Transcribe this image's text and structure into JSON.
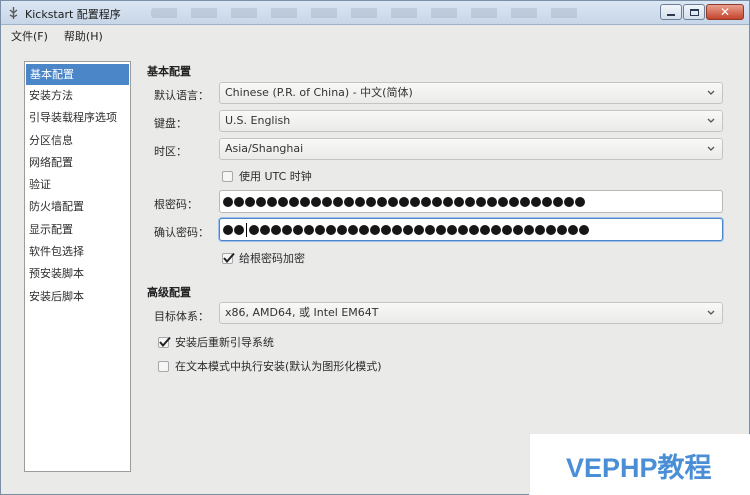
{
  "window": {
    "title": "Kickstart 配置程序",
    "controls": {
      "minimize_icon": "minimize-icon",
      "maximize_icon": "maximize-icon",
      "close_icon": "close-icon"
    }
  },
  "menubar": {
    "items": [
      {
        "label": "文件(F)"
      },
      {
        "label": "帮助(H)"
      }
    ]
  },
  "sidebar": {
    "items": [
      {
        "label": "基本配置",
        "selected": true
      },
      {
        "label": "安装方法"
      },
      {
        "label": "引导装载程序选项"
      },
      {
        "label": "分区信息"
      },
      {
        "label": "网络配置"
      },
      {
        "label": "验证"
      },
      {
        "label": "防火墙配置"
      },
      {
        "label": "显示配置"
      },
      {
        "label": "软件包选择"
      },
      {
        "label": "预安装脚本"
      },
      {
        "label": "安装后脚本"
      }
    ]
  },
  "basic": {
    "title": "基本配置",
    "language_label": "默认语言：",
    "language_value": "Chinese (P.R. of China) - 中文(简体)",
    "keyboard_label": "键盘：",
    "keyboard_value": "U.S. English",
    "timezone_label": "时区：",
    "timezone_value": "Asia/Shanghai",
    "utc_label": "使用 UTC 时钟",
    "utc_checked": false,
    "root_password_label": "根密码：",
    "confirm_password_label": "确认密码：",
    "encrypt_label": "给根密码加密",
    "encrypt_checked": true
  },
  "advanced": {
    "title": "高级配置",
    "arch_label": "目标体系：",
    "arch_value": "x86, AMD64, 或 Intel EM64T",
    "reboot_label": "安装后重新引导系统",
    "reboot_checked": true,
    "textmode_label": "在文本模式中执行安装(默认为图形化模式)",
    "textmode_checked": false
  },
  "watermark": {
    "text": "VEPHP教程"
  },
  "colors": {
    "selection": "#4a86c8",
    "watermark": "#4a8fd6"
  }
}
